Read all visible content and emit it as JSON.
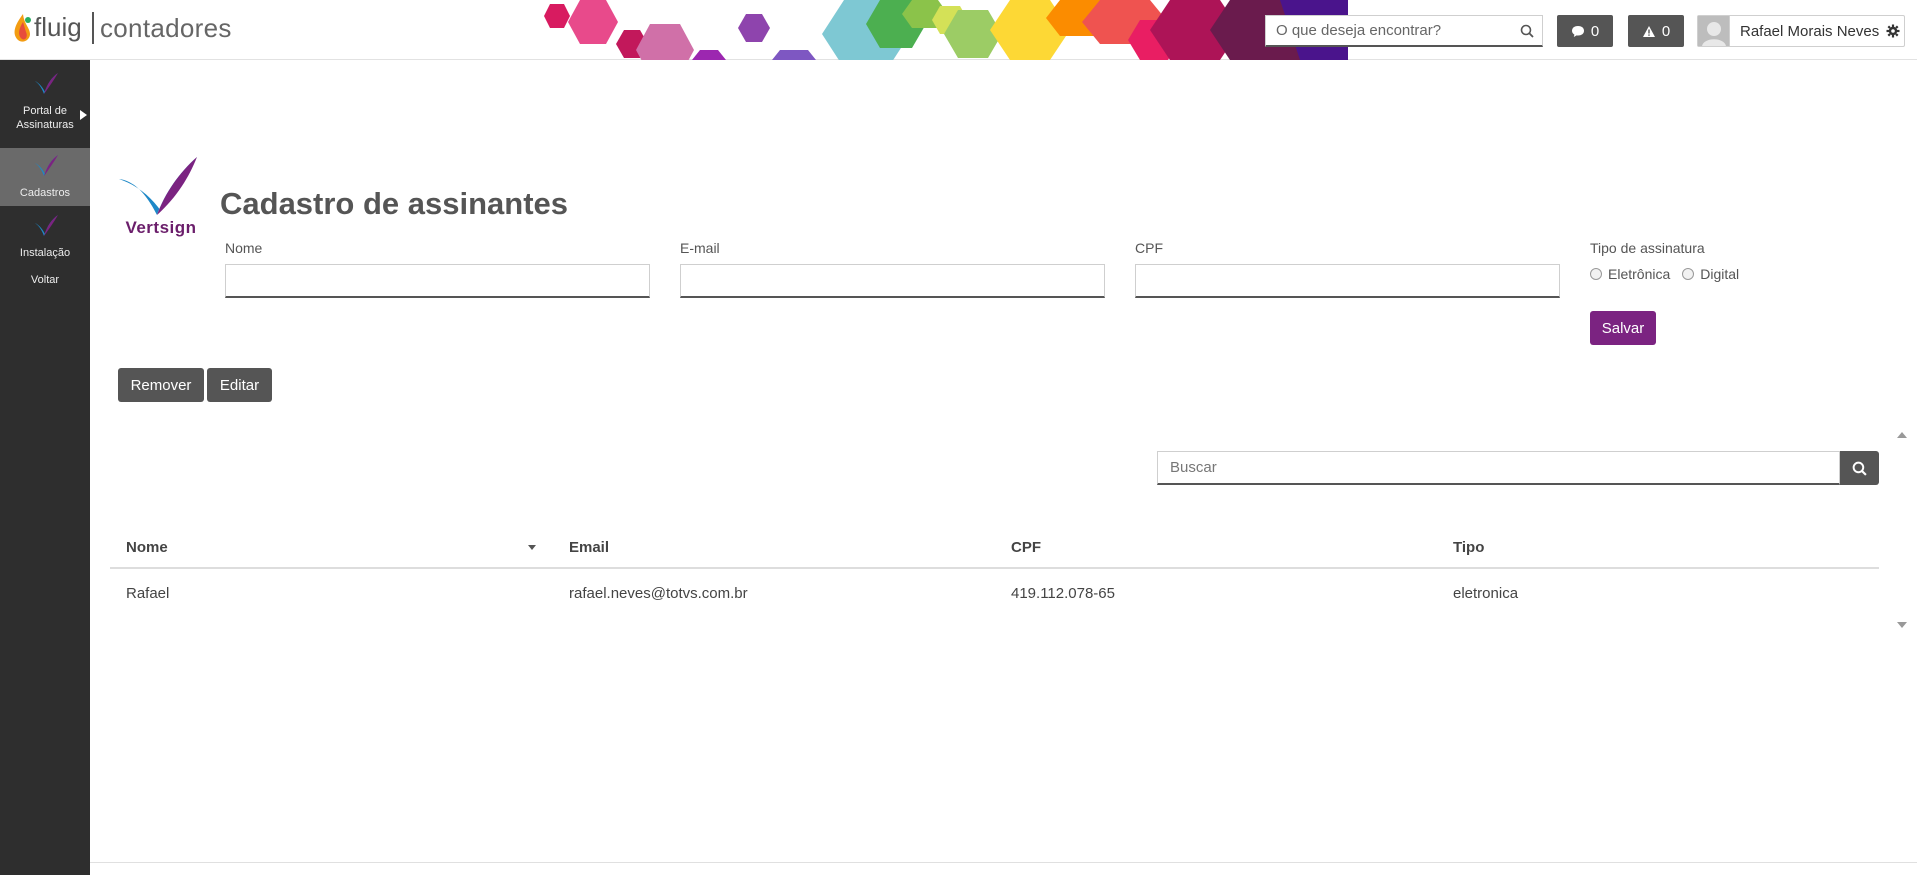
{
  "header": {
    "brand_word": "fluig",
    "brand_name": "contadores",
    "search": {
      "placeholder": "O que deseja encontrar?"
    },
    "messages_count": "0",
    "alerts_count": "0",
    "user_name": "Rafael Morais Neves"
  },
  "sidebar": {
    "items": [
      {
        "label": "Portal de Assinaturas",
        "icon": "vertsign-icon",
        "active": false
      },
      {
        "label": "Cadastros",
        "icon": "vertsign-icon",
        "active": true
      },
      {
        "label": "Instalação",
        "icon": "vertsign-icon",
        "active": false
      },
      {
        "label": "Voltar",
        "icon": "",
        "active": false
      }
    ]
  },
  "page": {
    "logo_text": "Vertsign",
    "title": "Cadastro de assinantes"
  },
  "form": {
    "nome_label": "Nome",
    "nome_value": "",
    "email_label": "E-mail",
    "email_value": "",
    "cpf_label": "CPF",
    "cpf_value": "",
    "tipo_label": "Tipo de assinatura",
    "tipo_options": [
      "Eletrônica",
      "Digital"
    ],
    "save_label": "Salvar"
  },
  "actions": {
    "remove_label": "Remover",
    "edit_label": "Editar"
  },
  "table": {
    "search_placeholder": "Buscar",
    "columns": [
      "Nome",
      "Email",
      "CPF",
      "Tipo"
    ],
    "rows": [
      [
        "Rafael",
        "rafael.neves@totvs.com.br",
        "419.112.078-65",
        "eletronica"
      ]
    ]
  },
  "colors": {
    "accent": "#7b2381",
    "dark_button": "#555555",
    "sidebar_bg": "#2e2e2e"
  }
}
